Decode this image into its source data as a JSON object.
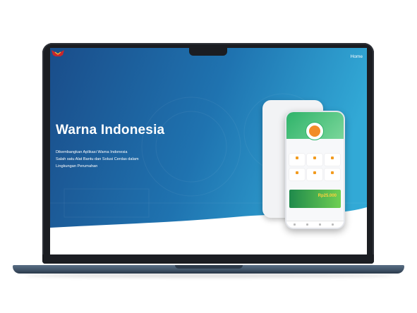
{
  "nav": {
    "home_label": "Home"
  },
  "hero": {
    "title": "Warna Indonesia",
    "description_lines": [
      "Dikembangkan Aplikasi Warna Indonesia",
      "Salah satu Alat Bantu dan Solusi Cerdas dalam",
      "Lingkungan Perumahan"
    ]
  },
  "colors": {
    "hero_gradient_start": "#134f8c",
    "hero_gradient_end": "#2a9fd0",
    "app_green": "#2fb36a",
    "accent_orange": "#f29b1f"
  },
  "phone": {
    "banner_text": "Rp25.000"
  },
  "icons": [
    "logo-icon",
    "avatar-icon"
  ]
}
